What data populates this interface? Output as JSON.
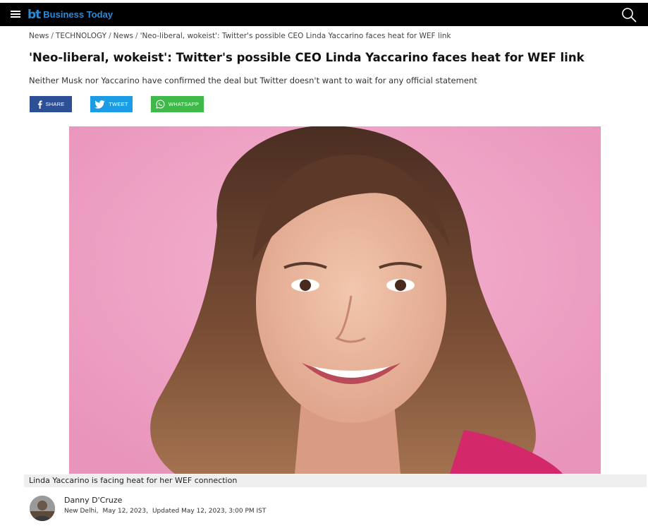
{
  "header": {
    "logo_mark": "bt",
    "logo_text": "Business Today",
    "brand_color": "#2a8bd8",
    "menu_icon": "hamburger-menu-icon",
    "search_icon": "search-icon"
  },
  "breadcrumb": [
    {
      "label": "News"
    },
    {
      "label": "TECHNOLOGY"
    },
    {
      "label": "News"
    },
    {
      "label": "'Neo-liberal, wokeist': Twitter's possible CEO Linda Yaccarino faces heat for WEF link"
    }
  ],
  "article": {
    "headline": "'Neo-liberal, wokeist': Twitter's possible CEO Linda Yaccarino faces heat for WEF link",
    "subheadline": "Neither Musk nor Yaccarino have confirmed the deal but Twitter doesn't want to wait for any official statement",
    "image_caption": "Linda Yaccarino is facing heat for her WEF connection"
  },
  "share": {
    "facebook": {
      "label": "SHARE",
      "color": "#2d4f96",
      "icon": "facebook-icon"
    },
    "twitter": {
      "label": "TWEET",
      "color": "#1c9ce5",
      "icon": "twitter-icon"
    },
    "whatsapp": {
      "label": "WHATSAPP",
      "color": "#3fb949",
      "icon": "whatsapp-icon"
    }
  },
  "author": {
    "name": "Danny D'Cruze",
    "location": "New Delhi,",
    "published": "May 12, 2023,",
    "updated": "Updated May 12, 2023, 3:00 PM IST"
  }
}
